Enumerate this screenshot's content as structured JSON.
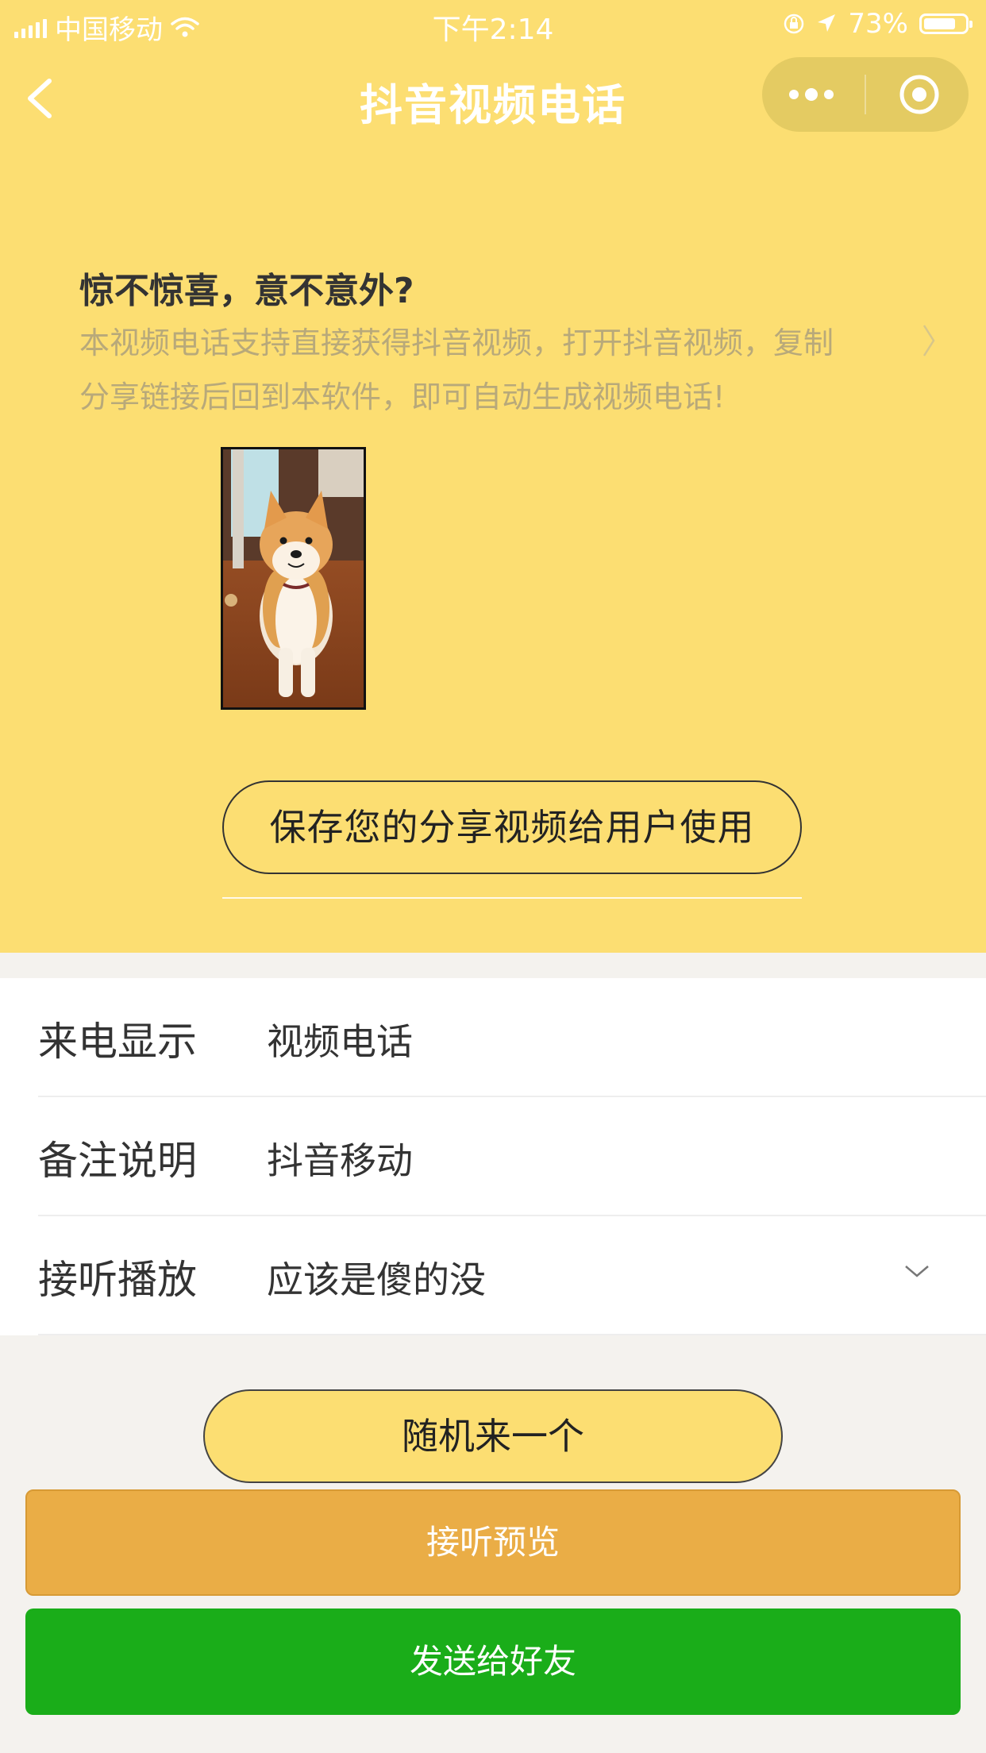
{
  "status_bar": {
    "carrier": "中国移动",
    "time": "下午2:14",
    "battery": "73%",
    "battery_level": 0.73,
    "icons": [
      "signal-icon",
      "wifi-icon",
      "lock-rotation-icon",
      "location-icon",
      "battery-icon"
    ]
  },
  "nav": {
    "title": "抖音视频电话",
    "icons": [
      "back-icon",
      "more-icon",
      "target-icon"
    ]
  },
  "promo": {
    "title": "惊不惊喜，意不意外?",
    "desc_line1": "本视频电话支持直接获得抖音视频，打开抖音视频，复制",
    "desc_line2": "分享链接后回到本软件，即可自动生成视频电话!"
  },
  "buttons": {
    "save_share": "保存您的分享视频给用户使用",
    "random": "随机来一个",
    "preview": "接听预览",
    "send": "发送给好友"
  },
  "form": {
    "rows": [
      {
        "label": "来电显示",
        "value": "视频电话"
      },
      {
        "label": "备注说明",
        "value": "抖音移动"
      },
      {
        "label": "接听播放",
        "value": "应该是傻的没"
      }
    ]
  },
  "colors": {
    "hero_bg": "#fcde72",
    "preview_btn": "#eaad46",
    "send_btn": "#1aad19"
  }
}
